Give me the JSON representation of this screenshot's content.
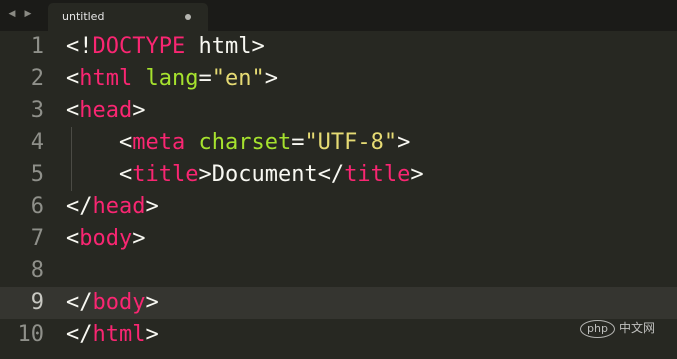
{
  "tab": {
    "title": "untitled",
    "dirty_indicator": "•"
  },
  "nav": {
    "back_icon": "◀",
    "forward_icon": "▶"
  },
  "editor": {
    "current_line": 9,
    "lines": [
      {
        "n": "1",
        "segments": [
          "<!",
          "DOCTYPE",
          " html>"
        ]
      },
      {
        "n": "2",
        "segments": [
          "<",
          "html",
          " ",
          "lang",
          "=",
          "\"en\"",
          ">"
        ]
      },
      {
        "n": "3",
        "segments": [
          "<",
          "head",
          ">"
        ]
      },
      {
        "n": "4",
        "segments": [
          "    <",
          "meta",
          " ",
          "charset",
          "=",
          "\"UTF-8\"",
          ">"
        ]
      },
      {
        "n": "5",
        "segments": [
          "    <",
          "title",
          ">",
          "Document",
          "</",
          "title",
          ">"
        ]
      },
      {
        "n": "6",
        "segments": [
          "</",
          "head",
          ">"
        ]
      },
      {
        "n": "7",
        "segments": [
          "<",
          "body",
          ">"
        ]
      },
      {
        "n": "8",
        "segments": [
          ""
        ]
      },
      {
        "n": "9",
        "segments": [
          "</",
          "body",
          ">"
        ]
      },
      {
        "n": "10",
        "segments": [
          "</",
          "html",
          ">"
        ]
      }
    ]
  },
  "watermark": {
    "logo": "php",
    "text": "中文网"
  },
  "colors": {
    "background": "#272822",
    "tag": "#f92672",
    "attribute": "#a6e22e",
    "string": "#e6db74",
    "text": "#f8f8f2"
  }
}
